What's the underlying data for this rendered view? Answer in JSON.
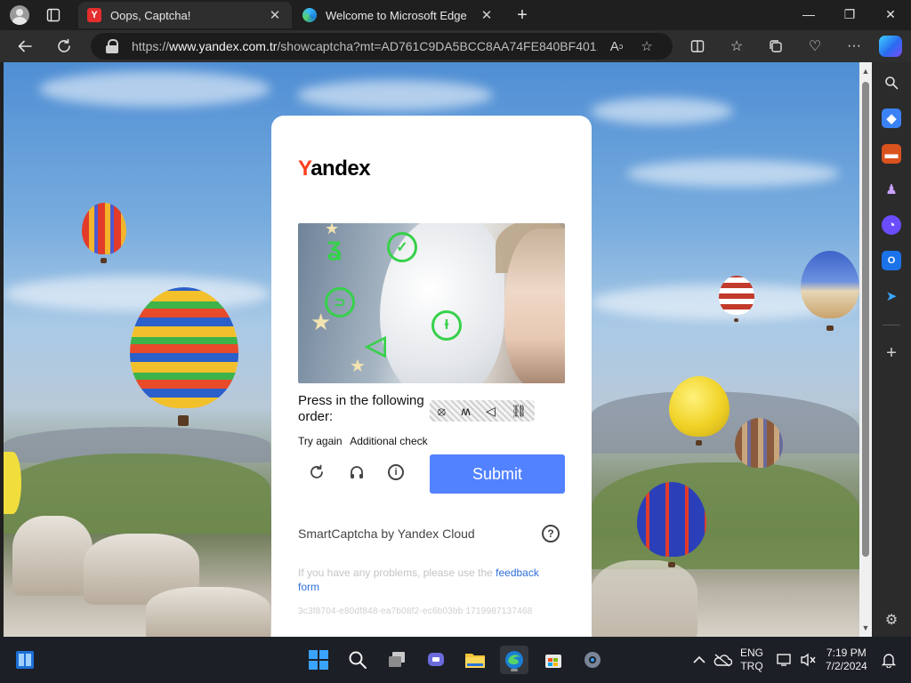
{
  "browser": {
    "tabs": [
      {
        "title": "Oops, Captcha!",
        "favicon": "yandex-icon",
        "active": true
      },
      {
        "title": "Welcome to Microsoft Edge",
        "favicon": "edge-icon",
        "active": false
      }
    ],
    "address": {
      "url_prefix": "https://",
      "url_domain": "www.yandex.com.tr",
      "url_rest": "/showcaptcha?mt=AD761C9DA5BCC8AA74FE840BF401..."
    },
    "window_controls": {
      "minimize": "—",
      "maximize": "❐",
      "close": "✕"
    },
    "new_tab": "+"
  },
  "captcha": {
    "logo_first": "Y",
    "logo_rest": "andex",
    "prompt": "Press in the following order:",
    "sequence": [
      "⦻",
      "ʍ",
      "◁",
      "⛓"
    ],
    "try_again": "Try again",
    "additional_check": "Additional check",
    "submit_label": "Submit",
    "brand": "SmartCaptcha by Yandex Cloud",
    "help_icon": "?",
    "problems_text": "If you have any problems, please use the",
    "feedback_link": "feedback form",
    "request_id": "3c3f8704-e80df848-ea7b08f2-ec6b03bb 1719987137468"
  },
  "taskbar": {
    "lang_top": "ENG",
    "lang_bottom": "TRQ",
    "time": "7:19 PM",
    "date": "7/2/2024"
  },
  "colors": {
    "accent": "#5282ff",
    "yandex_red": "#fc3f1d",
    "link": "#2e6fd9"
  }
}
